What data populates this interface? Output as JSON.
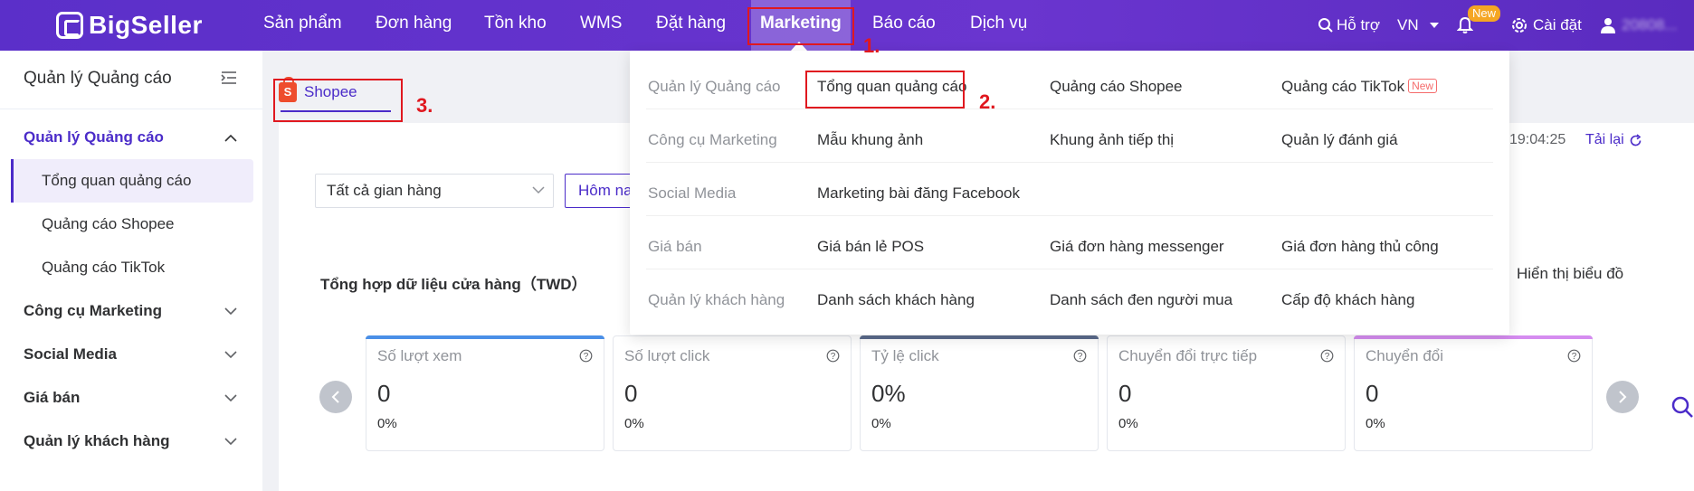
{
  "topnav": {
    "brand": "BigSeller",
    "items": [
      "Sản phẩm",
      "Đơn hàng",
      "Tồn kho",
      "WMS",
      "Đặt hàng",
      "Marketing",
      "Báo cáo",
      "Dịch vụ"
    ],
    "active": "Marketing",
    "support": "Hỗ trợ",
    "region": "VN",
    "new_badge": "New",
    "settings": "Cài đặt",
    "user": "20808..."
  },
  "annotations": [
    "1.",
    "2.",
    "3."
  ],
  "sidebar": {
    "title": "Quản lý Quảng cáo",
    "groups": [
      {
        "label": "Quản lý Quảng cáo",
        "open": true,
        "items": [
          "Tổng quan quảng cáo",
          "Quảng cáo Shopee",
          "Quảng cáo TikTok"
        ]
      },
      {
        "label": "Công cụ Marketing"
      },
      {
        "label": "Social Media"
      },
      {
        "label": "Giá bán"
      },
      {
        "label": "Quản lý khách hàng"
      }
    ]
  },
  "main": {
    "platform_tab": "Shopee",
    "store_select": "Tất cả gian hàng",
    "date_button": "Hôm nay",
    "updated_time": "19:04:25",
    "reload": "Tải lại",
    "summary_title": "Tổng hợp dữ liệu cửa hàng（TWD）",
    "chart_toggle": "Hiển thị biểu đồ",
    "metrics": [
      {
        "label": "Số lượt xem",
        "value": "0",
        "pct": "0%",
        "color": "#4a8fe7"
      },
      {
        "label": "Số lượt click",
        "value": "0",
        "pct": "0%",
        "color": "#ffffff"
      },
      {
        "label": "Tỷ lệ click",
        "value": "0%",
        "pct": "0%",
        "color": "#5b6b8c"
      },
      {
        "label": "Chuyển đổi trực tiếp",
        "value": "0",
        "pct": "0%",
        "color": "#ffffff"
      },
      {
        "label": "Chuyển đổi",
        "value": "0",
        "pct": "0%",
        "color": "#d58cf0"
      }
    ]
  },
  "dropdown": {
    "rows": [
      {
        "category": "Quản lý Quảng cáo",
        "links": [
          "Tổng quan quảng cáo",
          "Quảng cáo Shopee",
          "Quảng cáo TikTok"
        ],
        "new_tag": "New"
      },
      {
        "category": "Công cụ Marketing",
        "links": [
          "Mẫu khung ảnh",
          "Khung ảnh tiếp thị",
          "Quản lý đánh giá"
        ]
      },
      {
        "category": "Social Media",
        "links": [
          "Marketing bài đăng Facebook"
        ]
      },
      {
        "category": "Giá bán",
        "links": [
          "Giá bán lẻ POS",
          "Giá đơn hàng messenger",
          "Giá đơn hàng thủ công"
        ]
      },
      {
        "category": "Quản lý khách hàng",
        "links": [
          "Danh sách khách hàng",
          "Danh sách đen người mua",
          "Cấp độ khách hàng"
        ]
      }
    ]
  },
  "colors": {
    "brand": "#5b2fc9",
    "accent": "#4b2cc9",
    "annotation": "#e0181f"
  }
}
